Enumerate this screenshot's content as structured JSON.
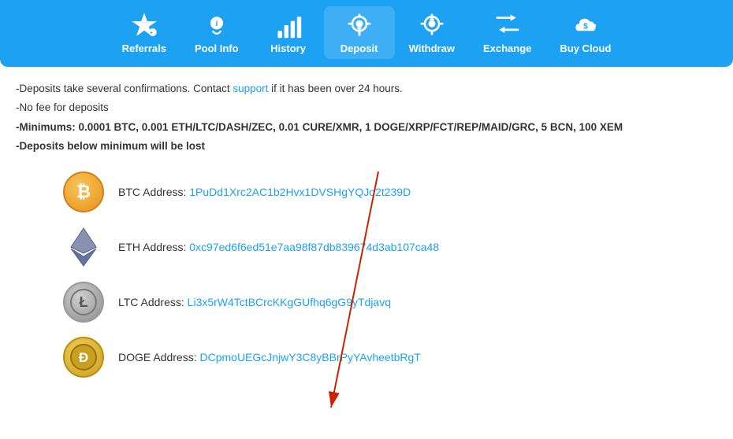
{
  "nav": {
    "items": [
      {
        "id": "referrals",
        "label": "Referrals",
        "icon": "star"
      },
      {
        "id": "pool-info",
        "label": "Pool Info",
        "icon": "cloud-info"
      },
      {
        "id": "history",
        "label": "History",
        "icon": "bar-chart"
      },
      {
        "id": "deposit",
        "label": "Deposit",
        "icon": "deposit",
        "active": true
      },
      {
        "id": "withdraw",
        "label": "Withdraw",
        "icon": "withdraw"
      },
      {
        "id": "exchange",
        "label": "Exchange",
        "icon": "exchange"
      },
      {
        "id": "buy-cloud",
        "label": "Buy Cloud",
        "icon": "buy-cloud"
      }
    ]
  },
  "info": {
    "line1": "-Deposits take several confirmations. Contact ",
    "link_text": "support",
    "line1b": " if it has been over 24 hours.",
    "line2": "-No fee for deposits",
    "line3": "-Minimums: 0.0001 BTC, 0.001 ETH/LTC/DASH/ZEC, 0.01 CURE/XMR, 1 DOGE/XRP/FCT/REP/MAID/GRC, 5 BCN, 100 XEM",
    "line4": "-Deposits below minimum will be lost"
  },
  "coins": [
    {
      "id": "btc",
      "symbol": "BTC",
      "label": "BTC Address:",
      "address": "1PuDd1Xrc2AC1b2Hvx1DVSHgYQJo2t239D"
    },
    {
      "id": "eth",
      "symbol": "ETH",
      "label": "ETH Address:",
      "address": "0xc97ed6f6ed51e7aa98f87db839674d3ab107ca48"
    },
    {
      "id": "ltc",
      "symbol": "LTC",
      "label": "LTC Address:",
      "address": "Li3x5rW4TctBCrcKKgGUfhq6gG9yTdjavq"
    },
    {
      "id": "doge",
      "symbol": "DOGE",
      "label": "DOGE Address:",
      "address": "DCpmoUEGcJnjwY3C8yBBrPyYAvheetbRgT"
    }
  ],
  "colors": {
    "nav_bg": "#1da1f2",
    "link": "#1da1f2",
    "active_tab": "rgba(255,255,255,0.2)"
  }
}
